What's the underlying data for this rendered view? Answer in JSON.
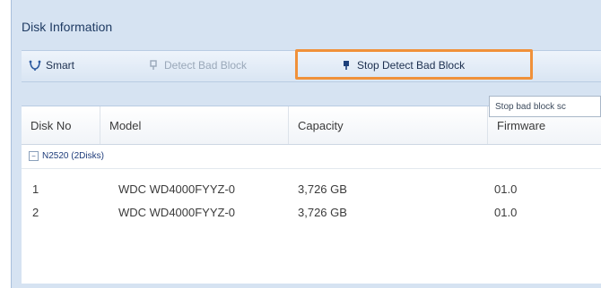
{
  "panel": {
    "title": "Disk Information"
  },
  "toolbar": {
    "smart_label": "Smart",
    "detect_label": "Detect Bad Block",
    "stop_label": "Stop Detect Bad Block"
  },
  "tooltip": {
    "text": "Stop bad block sc"
  },
  "table": {
    "columns": [
      "Disk No",
      "Model",
      "Capacity",
      "Firmware"
    ],
    "group": "N2520 (2Disks)",
    "rows": [
      {
        "no": "1",
        "model": "WDC WD4000FYYZ-0",
        "capacity": "3,726 GB",
        "firmware": "01.0"
      },
      {
        "no": "2",
        "model": "WDC WD4000FYYZ-0",
        "capacity": "3,726 GB",
        "firmware": "01.0"
      }
    ]
  },
  "colors": {
    "highlight": "#f0913a",
    "panel": "#d6e3f2"
  }
}
